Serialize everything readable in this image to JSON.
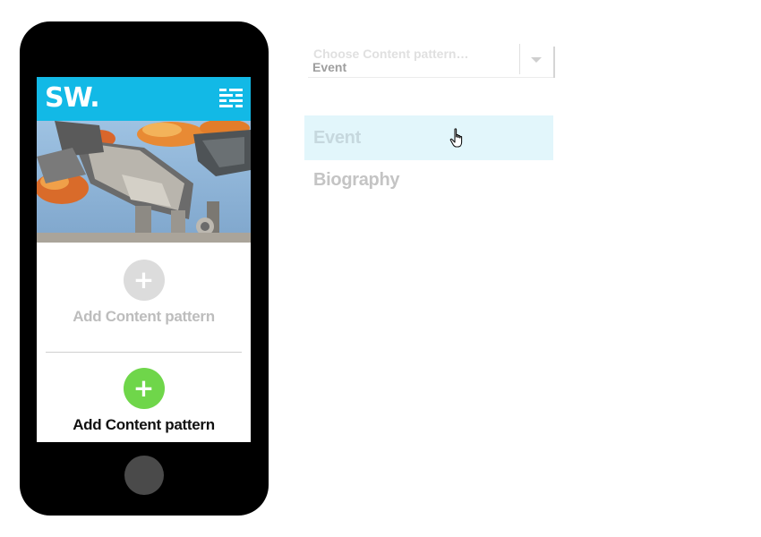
{
  "phone": {
    "logo": "SW.",
    "add_pattern_1": {
      "label": "Add Content pattern",
      "symbol": "+",
      "state": "disabled",
      "color": "#dcdcdc"
    },
    "add_pattern_2": {
      "label": "Add Content pattern",
      "symbol": "+",
      "state": "active",
      "color": "#6fd64a"
    },
    "header_color": "#12b9e6",
    "icons": {
      "menu": "menu-icon"
    }
  },
  "dropdown": {
    "placeholder": "Choose Content pattern…",
    "selected_value": "Event",
    "options": [
      {
        "label": "Event",
        "hovered": true
      },
      {
        "label": "Biography",
        "hovered": false
      }
    ],
    "hover_color": "#e2f6fb",
    "icons": {
      "arrow": "chevron-down-icon",
      "cursor": "hand-pointer-icon"
    }
  }
}
